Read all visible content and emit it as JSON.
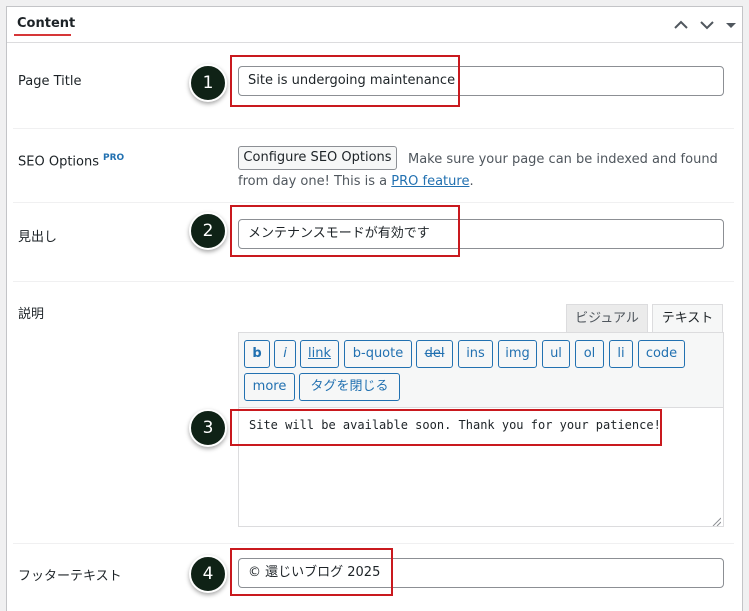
{
  "panel": {
    "title": "Content",
    "controls": {
      "up_icon": "chevron-up-icon",
      "down_icon": "chevron-down-icon"
    }
  },
  "fields": {
    "page_title": {
      "label": "Page Title",
      "value": "Site is undergoing maintenance"
    },
    "seo": {
      "label": "SEO Options",
      "pro_badge": "PRO",
      "button_label": "Configure SEO Options",
      "desc_prefix": "Make sure your page can be indexed and found from day one! This is a ",
      "desc_link": "PRO feature",
      "desc_suffix": "."
    },
    "heading": {
      "label": "見出し",
      "value": "メンテナンスモードが有効です"
    },
    "description": {
      "label": "説明",
      "tabs": [
        "ビジュアル",
        "テキスト"
      ],
      "active_tab": "テキスト",
      "quicktags": [
        "b",
        "i",
        "link",
        "b-quote",
        "del",
        "ins",
        "img",
        "ul",
        "ol",
        "li",
        "code",
        "more",
        "タグを閉じる"
      ],
      "value": "Site will be available soon. Thank you for your patience!"
    },
    "footer_text": {
      "label": "フッターテキスト",
      "value": "© 還じいブログ 2025"
    }
  },
  "badges": [
    "1",
    "2",
    "3",
    "4"
  ],
  "colors": {
    "callout_red": "#c9191e",
    "badge_bg": "#0f2216",
    "link_blue": "#2271b1"
  }
}
